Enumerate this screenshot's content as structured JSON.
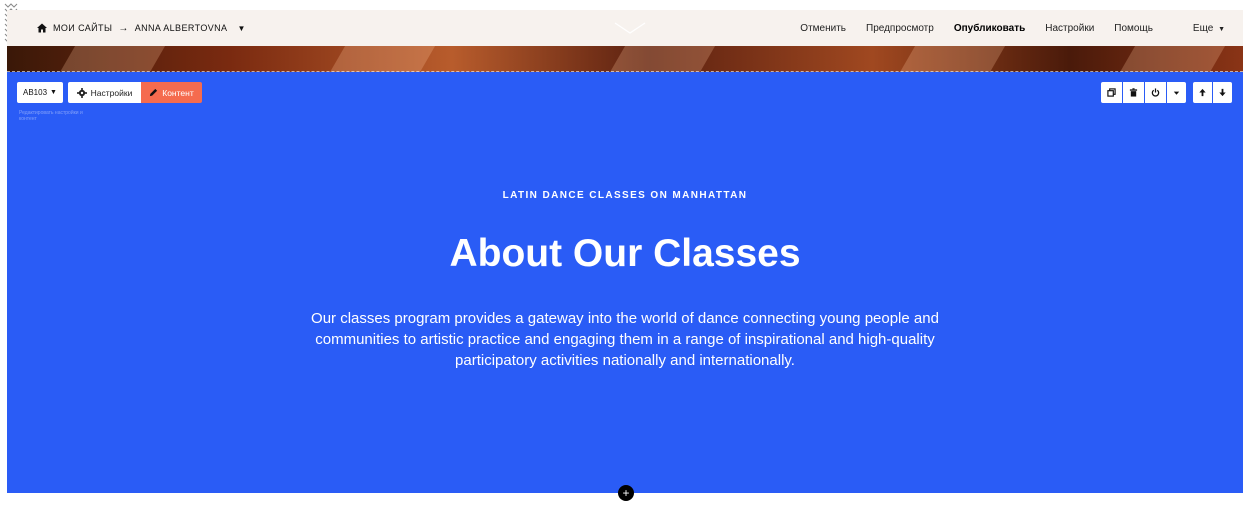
{
  "topbar": {
    "breadcrumb_root": "МОИ САЙТЫ",
    "breadcrumb_arrow": "→",
    "breadcrumb_site": "ANNA ALBERTOVNA",
    "menu": {
      "cancel": "Отменить",
      "preview": "Предпросмотр",
      "publish": "Опубликовать",
      "settings": "Настройки",
      "help": "Помощь",
      "more": "Еще"
    }
  },
  "block_toolbar": {
    "block_id": "AB103",
    "settings_label": "Настройки",
    "content_label": "Контент",
    "hint": "Редактировать настройки и контент"
  },
  "hero": {
    "eyebrow": "LATIN DANCE CLASSES ON MANHATTAN",
    "title": "About Our Classes",
    "description": "Our classes program provides a gateway into the world of dance connecting young people and communities to artistic practice and engaging them in a range of inspirational and high-quality participatory activities nationally and internationally."
  },
  "add_block": "+",
  "colors": {
    "hero_bg": "#2a5cf6",
    "content_button": "#f56b4e",
    "topbar_bg": "#f7f2ee"
  },
  "icons": [
    "logo-icon",
    "home-icon",
    "chevron-down-icon",
    "gear-icon",
    "pencil-icon",
    "duplicate-icon",
    "trash-icon",
    "power-icon",
    "caret-down-icon",
    "arrow-up-icon",
    "arrow-down-icon",
    "plus-icon"
  ]
}
